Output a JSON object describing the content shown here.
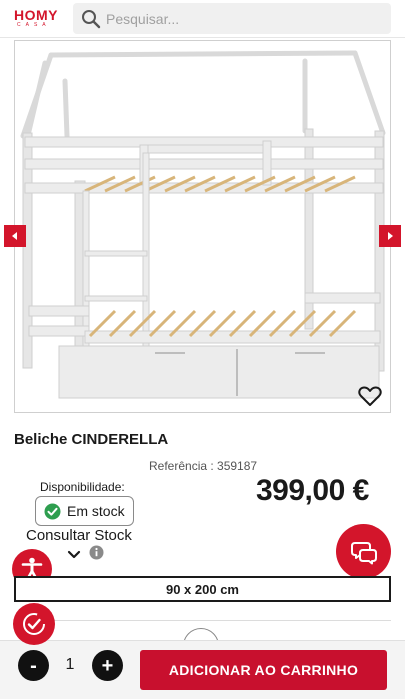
{
  "header": {
    "logo_text": "HOMY",
    "logo_subtext": "CASA",
    "search_placeholder": "Pesquisar..."
  },
  "product": {
    "title": "Beliche CINDERELLA",
    "reference": "Referência : 359187",
    "price": "399,00 €",
    "availability_label": "Disponibilidade:",
    "stock_status": "Em stock",
    "consult_stock": "Consultar Stock",
    "size": "90 x 200 cm"
  },
  "cart": {
    "quantity": "1",
    "minus_label": "-",
    "plus_label": "+",
    "add_label": "ADICIONAR AO CARRINHO"
  },
  "icons": {
    "search": "search-icon",
    "prev": "chevron-left-icon",
    "next": "chevron-right-icon",
    "favorite": "heart-icon",
    "stock_check": "check-circle-icon",
    "info": "info-icon",
    "chat": "chat-icon",
    "accessibility": "accessibility-icon",
    "clock": "clock-check-icon"
  },
  "colors": {
    "brand": "#d3152b",
    "stock_ok": "#2e9e4f"
  }
}
